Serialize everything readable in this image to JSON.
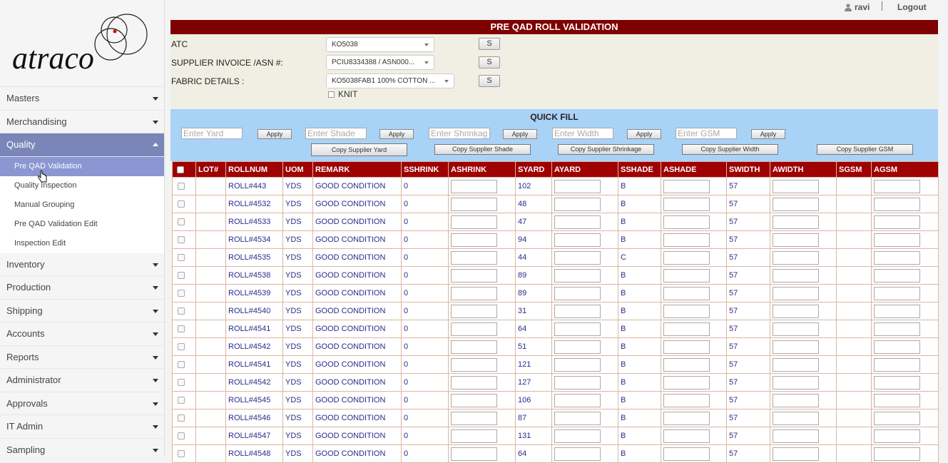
{
  "brand": {
    "logo_text": "atraco"
  },
  "header": {
    "user": "ravi",
    "logout": "Logout"
  },
  "sidebar": {
    "items": [
      {
        "label": "Masters"
      },
      {
        "label": "Merchandising"
      },
      {
        "label": "Quality",
        "active": true
      },
      {
        "label": "Inventory"
      },
      {
        "label": "Production"
      },
      {
        "label": "Shipping"
      },
      {
        "label": "Accounts"
      },
      {
        "label": "Reports"
      },
      {
        "label": "Administrator"
      },
      {
        "label": "Approvals"
      },
      {
        "label": "IT Admin"
      },
      {
        "label": "Sampling"
      }
    ],
    "quality_sub": [
      {
        "label": "Pre QAD Validation",
        "active": true
      },
      {
        "label": "Quality Inspection"
      },
      {
        "label": "Manual Grouping"
      },
      {
        "label": "Pre QAD Validation Edit"
      },
      {
        "label": "Inspection Edit"
      }
    ]
  },
  "page": {
    "title": "PRE QAD ROLL VALIDATION"
  },
  "form": {
    "atc_label": "ATC",
    "atc_value": "KO5038",
    "invoice_label": "SUPPLIER INVOICE /ASN #:",
    "invoice_value": "PCIU8334388 / ASN000...",
    "fabric_label": "FABRIC DETAILS :",
    "fabric_value": "KO5038FAB1 100% COTTON ...",
    "s_button": "S",
    "knit_label": "KNIT"
  },
  "quick_fill": {
    "title": "QUICK FILL",
    "placeholders": [
      "Enter Yard",
      "Enter Shade",
      "Enter Shrinkag",
      "Enter Width",
      "Enter GSM"
    ],
    "apply_label": "Apply",
    "copy_buttons": [
      "Copy Supplier Yard",
      "Copy Supplier Shade",
      "Copy Supplier Shrinkage",
      "Copy Supplier Width",
      "Copy Supplier GSM"
    ]
  },
  "table": {
    "columns": [
      "",
      "LOT#",
      "ROLLNUM",
      "UOM",
      "REMARK",
      "SSHRINK",
      "ASHRINK",
      "SYARD",
      "AYARD",
      "SSHADE",
      "ASHADE",
      "SWIDTH",
      "AWIDTH",
      "SGSM",
      "AGSM"
    ],
    "rows": [
      {
        "rollnum": "ROLL#443",
        "uom": "YDS",
        "remark": "GOOD CONDITION",
        "sshrink": "0",
        "syard": "102",
        "sshade": "B",
        "swidth": "57"
      },
      {
        "rollnum": "ROLL#4532",
        "uom": "YDS",
        "remark": "GOOD CONDITION",
        "sshrink": "0",
        "syard": "48",
        "sshade": "B",
        "swidth": "57"
      },
      {
        "rollnum": "ROLL#4533",
        "uom": "YDS",
        "remark": "GOOD CONDITION",
        "sshrink": "0",
        "syard": "47",
        "sshade": "B",
        "swidth": "57"
      },
      {
        "rollnum": "ROLL#4534",
        "uom": "YDS",
        "remark": "GOOD CONDITION",
        "sshrink": "0",
        "syard": "94",
        "sshade": "B",
        "swidth": "57"
      },
      {
        "rollnum": "ROLL#4535",
        "uom": "YDS",
        "remark": "GOOD CONDITION",
        "sshrink": "0",
        "syard": "44",
        "sshade": "C",
        "swidth": "57"
      },
      {
        "rollnum": "ROLL#4538",
        "uom": "YDS",
        "remark": "GOOD CONDITION",
        "sshrink": "0",
        "syard": "89",
        "sshade": "B",
        "swidth": "57"
      },
      {
        "rollnum": "ROLL#4539",
        "uom": "YDS",
        "remark": "GOOD CONDITION",
        "sshrink": "0",
        "syard": "89",
        "sshade": "B",
        "swidth": "57"
      },
      {
        "rollnum": "ROLL#4540",
        "uom": "YDS",
        "remark": "GOOD CONDITION",
        "sshrink": "0",
        "syard": "31",
        "sshade": "B",
        "swidth": "57"
      },
      {
        "rollnum": "ROLL#4541",
        "uom": "YDS",
        "remark": "GOOD CONDITION",
        "sshrink": "0",
        "syard": "64",
        "sshade": "B",
        "swidth": "57"
      },
      {
        "rollnum": "ROLL#4542",
        "uom": "YDS",
        "remark": "GOOD CONDITION",
        "sshrink": "0",
        "syard": "51",
        "sshade": "B",
        "swidth": "57"
      },
      {
        "rollnum": "ROLL#4541",
        "uom": "YDS",
        "remark": "GOOD CONDITION",
        "sshrink": "0",
        "syard": "121",
        "sshade": "B",
        "swidth": "57"
      },
      {
        "rollnum": "ROLL#4542",
        "uom": "YDS",
        "remark": "GOOD CONDITION",
        "sshrink": "0",
        "syard": "127",
        "sshade": "B",
        "swidth": "57"
      },
      {
        "rollnum": "ROLL#4545",
        "uom": "YDS",
        "remark": "GOOD CONDITION",
        "sshrink": "0",
        "syard": "106",
        "sshade": "B",
        "swidth": "57"
      },
      {
        "rollnum": "ROLL#4546",
        "uom": "YDS",
        "remark": "GOOD CONDITION",
        "sshrink": "0",
        "syard": "87",
        "sshade": "B",
        "swidth": "57"
      },
      {
        "rollnum": "ROLL#4547",
        "uom": "YDS",
        "remark": "GOOD CONDITION",
        "sshrink": "0",
        "syard": "131",
        "sshade": "B",
        "swidth": "57"
      },
      {
        "rollnum": "ROLL#4548",
        "uom": "YDS",
        "remark": "GOOD CONDITION",
        "sshrink": "0",
        "syard": "64",
        "sshade": "B",
        "swidth": "57"
      }
    ]
  },
  "colors": {
    "title_bar": "#7f0000",
    "table_header": "#9f0000",
    "quick_fill_bg": "#a9d2f7",
    "sidebar_active": "#7a86b8",
    "sidebar_sub_active": "#8b96d2"
  }
}
